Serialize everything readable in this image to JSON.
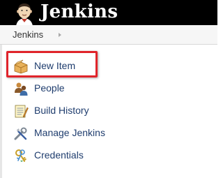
{
  "header": {
    "logo_text": "Jenkins",
    "logo_icon": "jenkins-butler-icon",
    "background": "#000000"
  },
  "breadcrumb": {
    "items": [
      {
        "label": "Jenkins"
      }
    ]
  },
  "tasks": [
    {
      "label": "New Item",
      "icon": "new-item-box-icon"
    },
    {
      "label": "People",
      "icon": "people-icon"
    },
    {
      "label": "Build History",
      "icon": "notepad-icon"
    },
    {
      "label": "Manage Jenkins",
      "icon": "wrench-screwdriver-icon"
    },
    {
      "label": "Credentials",
      "icon": "keys-icon"
    }
  ],
  "annotation": {
    "highlight_color": "#e0242b",
    "highlighted_task": "New Item"
  }
}
